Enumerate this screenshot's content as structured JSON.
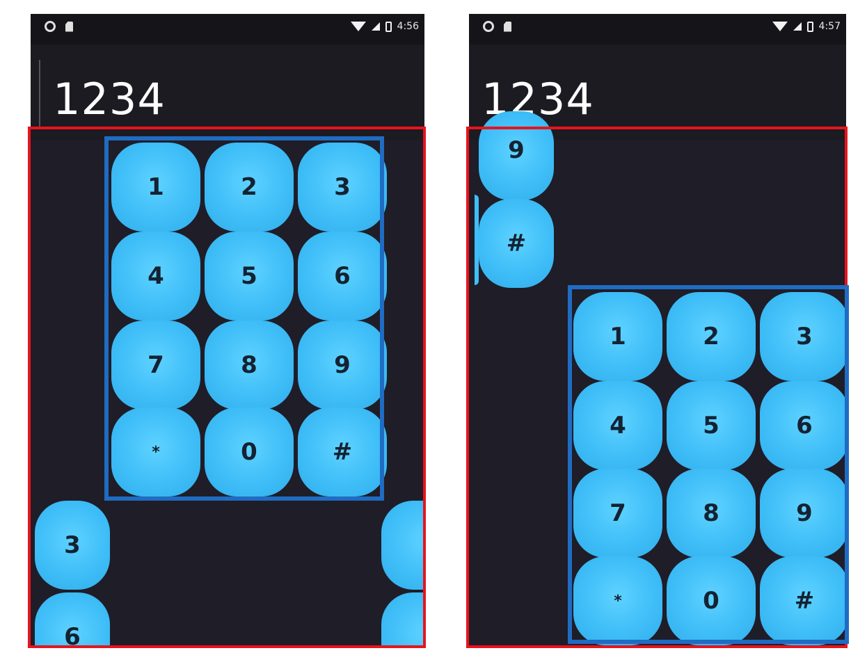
{
  "screens": [
    {
      "status_time": "4:56",
      "display_value": "1234",
      "keys": [
        "1",
        "2",
        "3",
        "4",
        "5",
        "6",
        "7",
        "8",
        "9",
        "*",
        "0",
        "#"
      ],
      "partial_keys": [
        "3",
        "6"
      ]
    },
    {
      "status_time": "4:57",
      "display_value": "1234",
      "keys": [
        "1",
        "2",
        "3",
        "4",
        "5",
        "6",
        "7",
        "8",
        "9",
        "*",
        "0",
        "#"
      ],
      "partial_keys": [
        "9",
        "#"
      ]
    }
  ],
  "colors": {
    "key_blue": "#3fbef8",
    "background": "#1f1d28",
    "red_frame": "#e8131d",
    "blue_frame": "#1f6cc2"
  }
}
